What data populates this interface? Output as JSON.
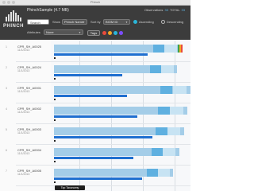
{
  "window": {
    "title": "Phinch"
  },
  "app": {
    "logo_text": "PHINCH"
  },
  "file": {
    "name": "PhinchSample (4.7 MB)"
  },
  "stats": {
    "observations_label": "Observations",
    "observations_value": "33",
    "total_label": "TOTAL",
    "total_value": "33"
  },
  "controls": {
    "search_placeholder": "Search",
    "show_label": "Show",
    "show_value": "Phinch Name",
    "sort_label": "Sort by",
    "sort_value": "BIOM ID",
    "ascending": "Ascending",
    "descending": "Descending",
    "attribute_label": "Attributes",
    "attribute_value": "None",
    "tags_label": "Tags",
    "tag_colors": [
      "#e94b3c",
      "#f5a623",
      "#2bb5d8",
      "#7c4dff"
    ]
  },
  "rows": [
    {
      "num": "1",
      "name": "CPR_SH_A0025",
      "date": "11/1/2013",
      "color": "#a4cde8"
    },
    {
      "num": "2",
      "name": "CPR_SH_A0024",
      "date": "11/1/2013",
      "color": "#a4cde8"
    },
    {
      "num": "3",
      "name": "CPR_SH_A0001",
      "date": "11/1/2013",
      "color": "#a4cde8"
    },
    {
      "num": "4",
      "name": "CPR_SH_A0002",
      "date": "11/1/2013",
      "color": "#a4cde8"
    },
    {
      "num": "5",
      "name": "CPR_SH_A0003",
      "date": "11/1/2013",
      "color": "#a4cde8"
    },
    {
      "num": "6",
      "name": "CPR_SH_A0004",
      "date": "11/1/2013",
      "color": "#a4cde8"
    },
    {
      "num": "7",
      "name": "CPR_SH_A0005",
      "date": "11/1/2013",
      "color": "#a4cde8"
    }
  ],
  "tooltip": {
    "text": "Top Taxonomy"
  }
}
